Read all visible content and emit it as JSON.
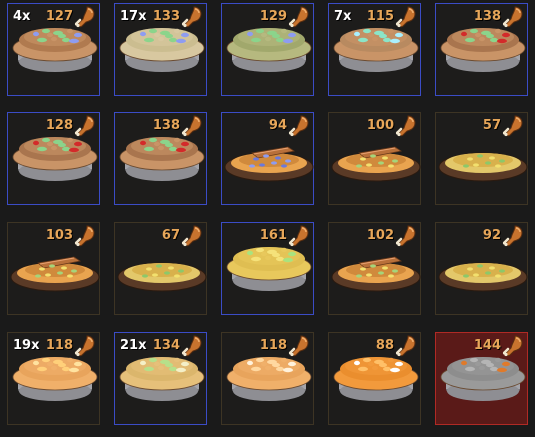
{
  "inventory": [
    {
      "count": "4x",
      "food": "127",
      "pie": "dish",
      "crust": "#c99467",
      "filling": "#b07a4f",
      "topping": "#8bd48b",
      "accent": "#8e9cf1",
      "border": "blue"
    },
    {
      "count": "17x",
      "food": "133",
      "pie": "dish",
      "crust": "#d8c8a0",
      "filling": "#cbbd90",
      "topping": "#8bd48b",
      "accent": "#8e9cf1",
      "border": "blue"
    },
    {
      "count": "",
      "food": "129",
      "pie": "dish",
      "crust": "#b6b97f",
      "filling": "#a1a86c",
      "topping": "#8bd48b",
      "accent": "#8e9cf1",
      "border": "blue"
    },
    {
      "count": "7x",
      "food": "115",
      "pie": "dish",
      "crust": "#c99467",
      "filling": "#b88a60",
      "topping": "#8be5c8",
      "accent": "#a9f0ff",
      "border": "blue"
    },
    {
      "count": "",
      "food": "138",
      "pie": "dish",
      "crust": "#c99467",
      "filling": "#a9754e",
      "topping": "#8bd48b",
      "accent": "#d32a2a",
      "border": "blue"
    },
    {
      "count": "",
      "food": "128",
      "pie": "dish",
      "crust": "#c99467",
      "filling": "#a9754e",
      "topping": "#8bd48b",
      "accent": "#d32a2a",
      "border": "blue"
    },
    {
      "count": "",
      "food": "138",
      "pie": "dish",
      "crust": "#c99467",
      "filling": "#a9754e",
      "topping": "#8bd48b",
      "accent": "#d32a2a",
      "border": "blue"
    },
    {
      "count": "",
      "food": "94",
      "pie": "plate",
      "crust": "#e9a44f",
      "filling": "#d08a3c",
      "topping": "#6b79dc",
      "accent": "#8e9cf1",
      "border": "blue"
    },
    {
      "count": "",
      "food": "100",
      "pie": "plate",
      "crust": "#e9a44f",
      "filling": "#d08a3c",
      "topping": "#f2e06e",
      "accent": "#a6d47a",
      "border": "brown"
    },
    {
      "count": "",
      "food": "57",
      "pie": "plate-flat",
      "crust": "#e3c86a",
      "filling": "#d8b14c",
      "topping": "#f2e06e",
      "accent": "#8cc86a",
      "border": "brown"
    },
    {
      "count": "",
      "food": "103",
      "pie": "plate",
      "crust": "#e9a44f",
      "filling": "#d08a3c",
      "topping": "#f2e06e",
      "accent": "#a6d47a",
      "border": "brown"
    },
    {
      "count": "",
      "food": "67",
      "pie": "plate-flat",
      "crust": "#e3c86a",
      "filling": "#d8b14c",
      "topping": "#f2e06e",
      "accent": "#8cc86a",
      "border": "brown"
    },
    {
      "count": "",
      "food": "161",
      "pie": "dish",
      "crust": "#e8c85c",
      "filling": "#dfbe52",
      "topping": "#f5e27a",
      "accent": "#a8e37f",
      "border": "blue"
    },
    {
      "count": "",
      "food": "102",
      "pie": "plate",
      "crust": "#e9a44f",
      "filling": "#d08a3c",
      "topping": "#f2e06e",
      "accent": "#a6d47a",
      "border": "brown"
    },
    {
      "count": "",
      "food": "92",
      "pie": "plate-flat",
      "crust": "#e3c86a",
      "filling": "#d8b14c",
      "topping": "#f2e06e",
      "accent": "#8cc86a",
      "border": "brown"
    },
    {
      "count": "19x",
      "food": "118",
      "pie": "dish",
      "crust": "#f0b06a",
      "filling": "#e8a45c",
      "topping": "#ffd07a",
      "accent": "#ffe3a0",
      "border": "brown"
    },
    {
      "count": "21x",
      "food": "134",
      "pie": "dish",
      "crust": "#e6c07a",
      "filling": "#dbb66c",
      "topping": "#b6e08a",
      "accent": "#f4f0c8",
      "border": "blue"
    },
    {
      "count": "",
      "food": "118",
      "pie": "dish",
      "crust": "#f0b06a",
      "filling": "#e8a45c",
      "topping": "#ffd8a0",
      "accent": "#fff2dc",
      "border": "brown"
    },
    {
      "count": "",
      "food": "88",
      "pie": "dish",
      "crust": "#f29a3c",
      "filling": "#ea8e2e",
      "topping": "#ffc068",
      "accent": "#ffffff",
      "border": "brown"
    },
    {
      "count": "",
      "food": "144",
      "pie": "dish",
      "crust": "#9a9a9a",
      "filling": "#8d8d8d",
      "topping": "#b5b5b5",
      "accent": "#e07a2a",
      "border": "red"
    }
  ]
}
